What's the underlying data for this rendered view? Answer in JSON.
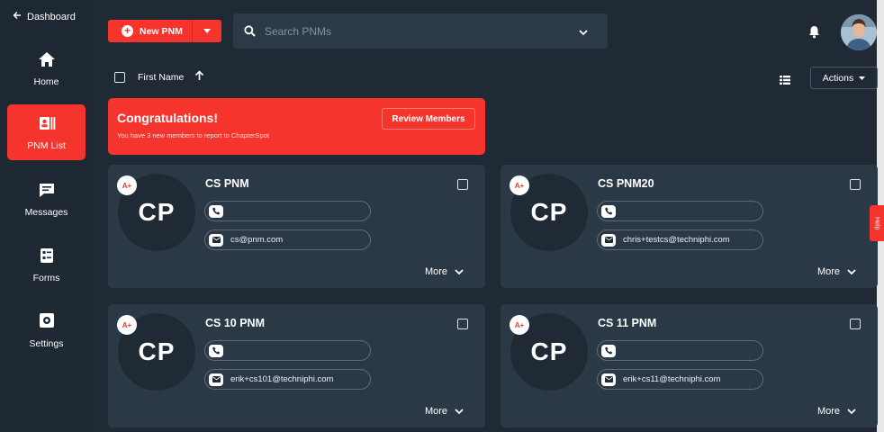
{
  "sidebar": {
    "back_label": "Dashboard",
    "items": [
      {
        "label": "Home",
        "icon": "home-icon"
      },
      {
        "label": "PNM List",
        "icon": "pnm-list-icon",
        "active": true
      },
      {
        "label": "Messages",
        "icon": "messages-icon"
      },
      {
        "label": "Forms",
        "icon": "forms-icon"
      },
      {
        "label": "Settings",
        "icon": "settings-icon"
      }
    ]
  },
  "toolbar": {
    "new_button_label": "New PNM",
    "search_placeholder": "Search PNMs",
    "actions_label": "Actions"
  },
  "sort": {
    "field_label": "First Name"
  },
  "banner": {
    "title": "Congratulations!",
    "subtitle": "You have 3 new members to report to ChapterSpot",
    "button_label": "Review Members"
  },
  "cards": [
    {
      "initials": "CP",
      "badge": "A+",
      "name": "CS PNM",
      "phone": "",
      "email": "cs@pnm.com",
      "more_label": "More"
    },
    {
      "initials": "CP",
      "badge": "A+",
      "name": "CS PNM20",
      "phone": "",
      "email": "chris+testcs@techniphi.com",
      "more_label": "More"
    },
    {
      "initials": "CP",
      "badge": "A+",
      "name": "CS 10 PNM",
      "phone": "",
      "email": "erik+cs101@techniphi.com",
      "more_label": "More"
    },
    {
      "initials": "CP",
      "badge": "A+",
      "name": "CS 11 PNM",
      "phone": "",
      "email": "erik+cs11@techniphi.com",
      "more_label": "More"
    }
  ],
  "help_tab": "Help",
  "colors": {
    "accent": "#f5342d",
    "sidebar_bg": "#1d2833",
    "card_bg": "#2b3947"
  }
}
